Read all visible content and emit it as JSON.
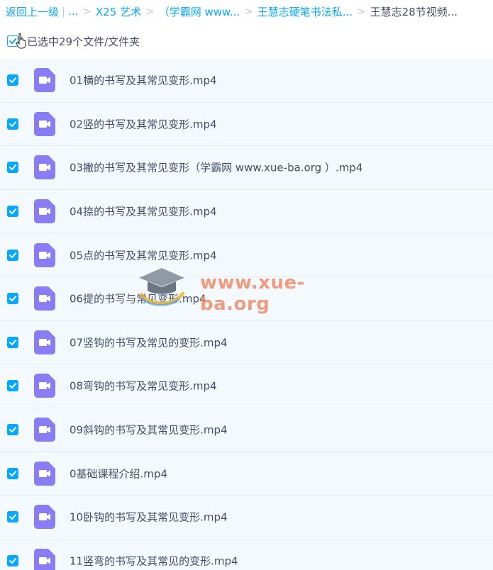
{
  "breadcrumb": {
    "back": "返回上一级",
    "divider": "|",
    "ellipsis": "...",
    "items": [
      "X25 艺术",
      "（学霸网 www...",
      "王慧志硬笔书法私..."
    ],
    "current": "王慧志28节视频...",
    "separator": ">"
  },
  "selection": {
    "label": "已选中29个文件/文件夹"
  },
  "files": [
    "01横的书写及其常见变形.mp4",
    "02竖的书写及其常见变形.mp4",
    "03撇的书写及其常见变形（学霸网 www.xue-ba.org ）.mp4",
    "04捺的书写及其常见变形.mp4",
    "05点的书写及其常见变形.mp4",
    "06提的书写与常见变形.mp4",
    "07竖钩的书写及常见的变形.mp4",
    "08弯钩的书写及常见变形.mp4",
    "09斜钩的书写及其常见变形.mp4",
    "0基础课程介绍.mp4",
    "10卧钩的书写及其常见变形.mp4",
    "11竖弯的书写及其常见的变形.mp4"
  ],
  "watermark": "www.xue-ba.org",
  "icons": {
    "file": "video-file-icon",
    "checkbox": "checkmark-icon"
  },
  "colors": {
    "accent": "#06a7ff",
    "video_icon": "#8a7cf2",
    "row_bg": "#f4f9fe"
  }
}
